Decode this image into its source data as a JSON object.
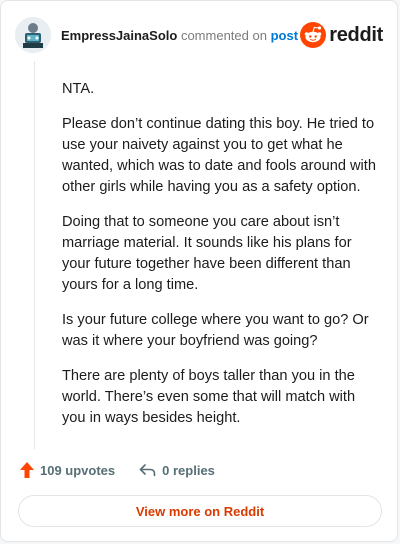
{
  "header": {
    "username": "EmpressJainaSolo",
    "action": "commented on",
    "post_link": "post",
    "brand_name": "reddit"
  },
  "comment": {
    "paragraphs": [
      "NTA.",
      "Please don’t continue dating this boy. He tried to use your naivety against you to get what he wanted, which was to date and fools around with other girls while having you as a safety option.",
      "Doing that to someone you care about isn’t marriage material. It sounds like his plans for your future together have been different than yours for a long time.",
      "Is your future college where you want to go? Or was it where your boyfriend was going?",
      "There are plenty of boys taller than you in the world. There’s even some that will match with you in ways besides height."
    ]
  },
  "footer": {
    "upvotes": "109 upvotes",
    "replies": "0 replies"
  },
  "view_more_label": "View more on Reddit",
  "colors": {
    "accent": "#d93a00",
    "upvote": "#ff4500",
    "link": "#0079d3"
  },
  "icons": {
    "avatar": "avatar",
    "brand": "reddit-logo-icon",
    "upvote": "upvote-arrow-icon",
    "reply": "reply-icon"
  }
}
